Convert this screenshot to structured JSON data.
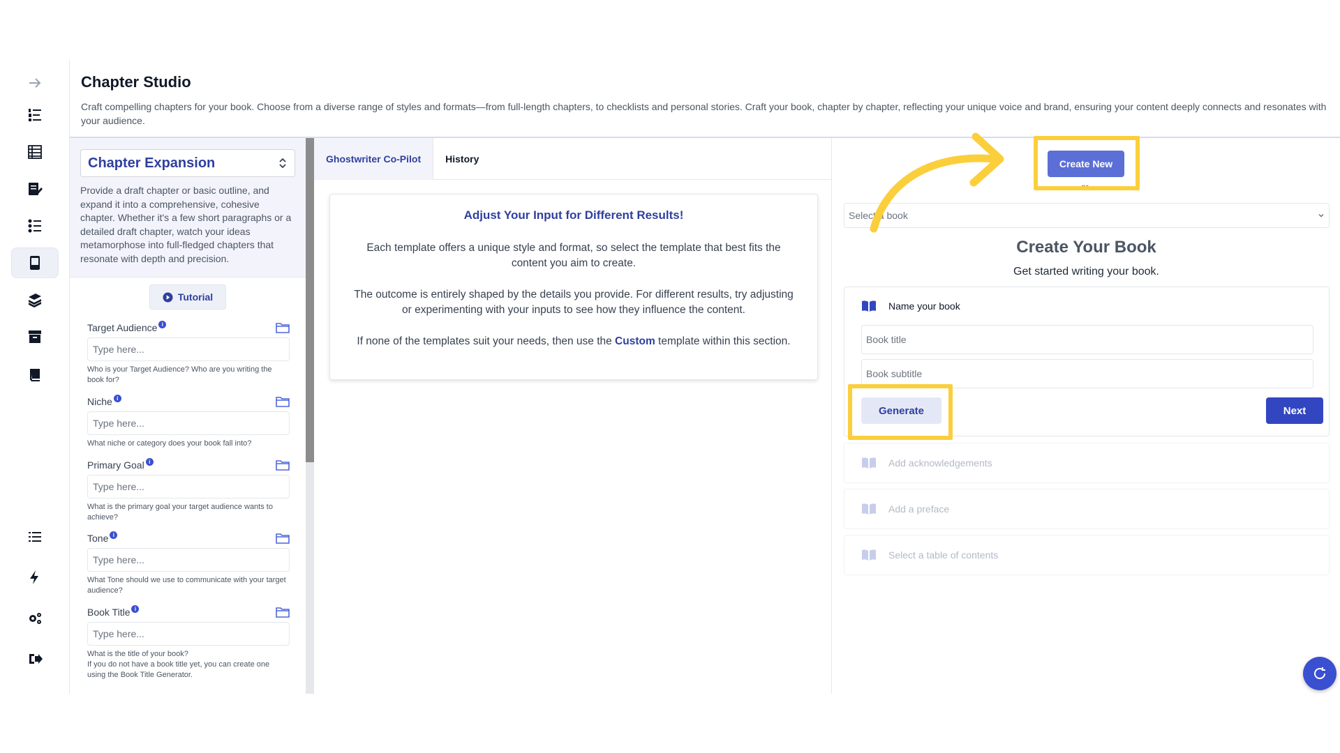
{
  "header": {
    "title": "Chapter Studio",
    "description": "Craft compelling chapters for your book. Choose from a diverse range of styles and formats—from full-length chapters, to checklists and personal stories. Craft your book, chapter by chapter, reflecting your unique voice and brand, ensuring your content deeply connects and resonates with your audience."
  },
  "rail": {
    "icons": [
      "arrow-right-icon",
      "numbered-list-icon",
      "table-list-icon",
      "edit-document-icon",
      "checklist-icon",
      "book-device-icon",
      "books-stack-icon",
      "archive-icon",
      "book-icon",
      "list-icon",
      "bolt-icon",
      "gears-icon",
      "sign-out-icon"
    ],
    "active_index": 5
  },
  "template": {
    "selected": "Chapter Expansion",
    "description": "Provide a draft chapter or basic outline, and expand it into a comprehensive, cohesive chapter. Whether it's a few short paragraphs or a detailed draft chapter, watch your ideas metamorphose into full-fledged chapters that resonate with depth and precision.",
    "tutorial_label": "Tutorial"
  },
  "fields": [
    {
      "label": "Target Audience",
      "placeholder": "Type here...",
      "help": "Who is your Target Audience? Who are you writing the book for?"
    },
    {
      "label": "Niche",
      "placeholder": "Type here...",
      "help": "What niche or category does your book fall into?"
    },
    {
      "label": "Primary Goal",
      "placeholder": "Type here...",
      "help": "What is the primary goal your target audience wants to achieve?"
    },
    {
      "label": "Tone",
      "placeholder": "Type here...",
      "help": "What Tone should we use to communicate with your target audience?"
    },
    {
      "label": "Book Title",
      "placeholder": "Type here...",
      "help": "What is the title of your book?\nIf you do not have a book title yet, you can create one using the Book Title Generator."
    }
  ],
  "tabs": [
    {
      "label": "Ghostwriter Co-Pilot",
      "active": true
    },
    {
      "label": "History",
      "active": false
    }
  ],
  "tips": {
    "title": "Adjust Your Input for Different Results!",
    "p1": "Each template offers a unique style and format, so select the template that best fits the content you aim to create.",
    "p2": "The outcome is entirely shaped by the details you provide. For different results, try adjusting or experimenting with your inputs to see how they influence the content.",
    "p3_before": "If none of the templates suit your needs, then use the ",
    "p3_link": "Custom",
    "p3_after": " template within this section."
  },
  "book": {
    "create_new_label": "Create New",
    "or_label": "or",
    "select_placeholder": "Select a book",
    "title": "Create Your Book",
    "subtitle": "Get started writing your book.",
    "step_name": "Name your book",
    "title_placeholder": "Book title",
    "subtitle_placeholder": "Book subtitle",
    "generate_label": "Generate",
    "next_label": "Next",
    "steps": [
      "Add acknowledgements",
      "Add a preface",
      "Select a table of contents"
    ]
  },
  "colors": {
    "accent": "#2f3f9e",
    "primary_button": "#3346c2",
    "highlight": "#fbcf3b"
  }
}
